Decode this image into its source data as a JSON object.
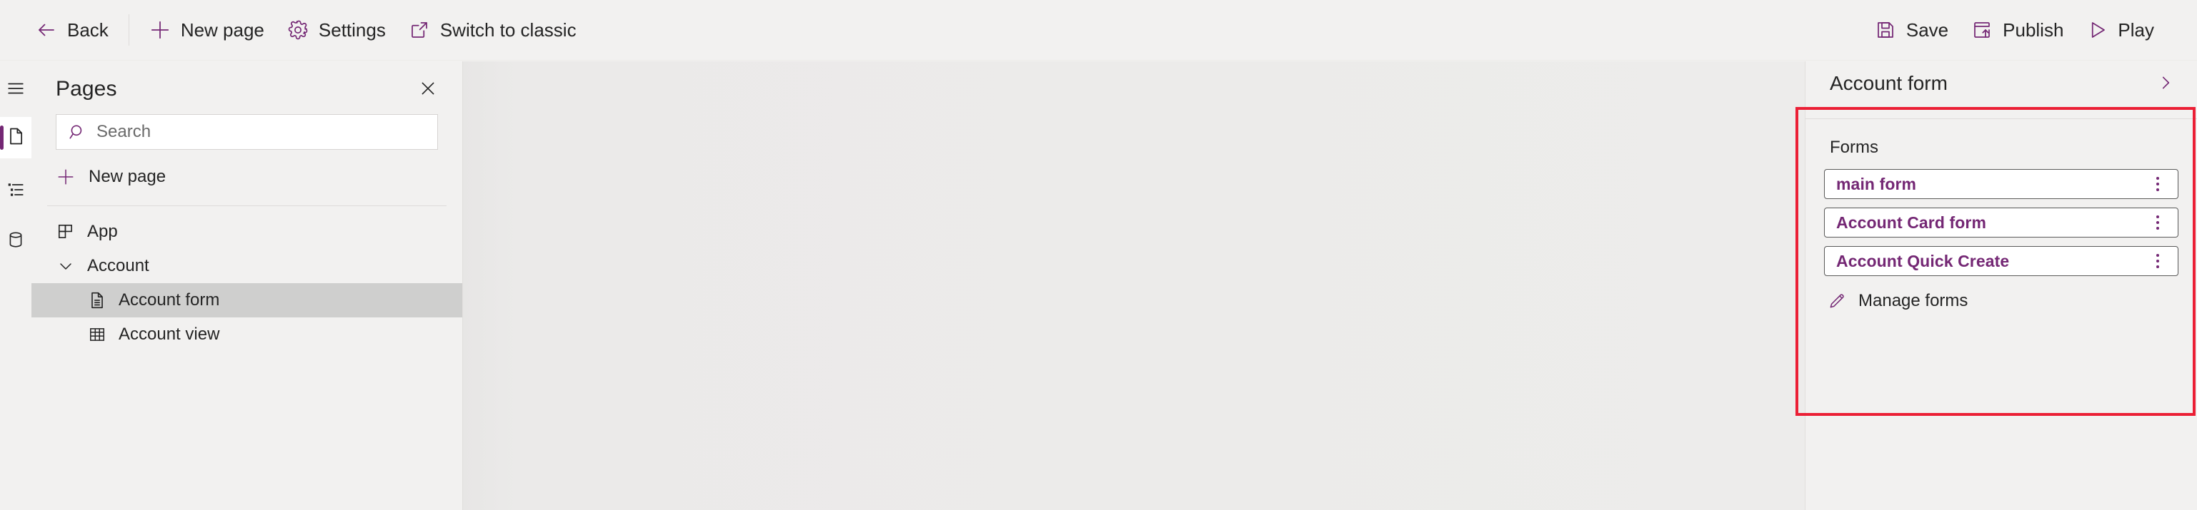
{
  "commandbar": {
    "left_items": [
      {
        "label": "Back",
        "icon": "arrow-left-icon"
      },
      {
        "label": "New page",
        "icon": "plus-icon"
      },
      {
        "label": "Settings",
        "icon": "gear-icon"
      },
      {
        "label": "Switch to classic",
        "icon": "open-external-icon"
      }
    ],
    "right_items": [
      {
        "label": "Save",
        "icon": "save-icon"
      },
      {
        "label": "Publish",
        "icon": "publish-icon"
      },
      {
        "label": "Play",
        "icon": "play-icon"
      }
    ]
  },
  "rail": {
    "items": [
      {
        "icon": "hamburger-menu-icon",
        "name": "hamburger"
      },
      {
        "icon": "page-icon",
        "name": "pages",
        "selected": true
      },
      {
        "icon": "navigation-tree-icon",
        "name": "navigation",
        "selected": false
      },
      {
        "icon": "database-icon",
        "name": "data",
        "selected": false
      }
    ]
  },
  "pages_panel": {
    "title": "Pages",
    "close_icon": "close-icon",
    "search": {
      "placeholder": "Search",
      "value": "",
      "icon": "search-icon"
    },
    "new_page": {
      "label": "New page",
      "icon": "plus-icon"
    },
    "tree": [
      {
        "label": "App",
        "icon": "app-grid-icon",
        "level": 1,
        "selected": false,
        "expandable": false
      },
      {
        "label": "Account",
        "icon": "chevron-down-icon",
        "level": 1,
        "selected": false,
        "expandable": true
      },
      {
        "label": "Account form",
        "icon": "form-document-icon",
        "level": 2,
        "selected": true,
        "expandable": false
      },
      {
        "label": "Account view",
        "icon": "table-grid-icon",
        "level": 2,
        "selected": false,
        "expandable": false
      }
    ]
  },
  "properties_panel": {
    "title": "Account form",
    "expand_icon": "chevron-right-icon",
    "section_label": "Forms",
    "forms": [
      {
        "label": "main form",
        "menu_icon": "kebab-menu-icon"
      },
      {
        "label": "Account Card form",
        "menu_icon": "kebab-menu-icon"
      },
      {
        "label": "Account Quick Create",
        "menu_icon": "kebab-menu-icon"
      }
    ],
    "manage_forms": {
      "label": "Manage forms",
      "icon": "pencil-edit-icon"
    }
  },
  "colors": {
    "accent_purple": "#742774",
    "annotation_red": "#EB1F35",
    "app_background": "#F2F1F0",
    "canvas_background": "#EBEAE9",
    "selected_row": "#CFCFCE",
    "text_primary": "#242424"
  }
}
